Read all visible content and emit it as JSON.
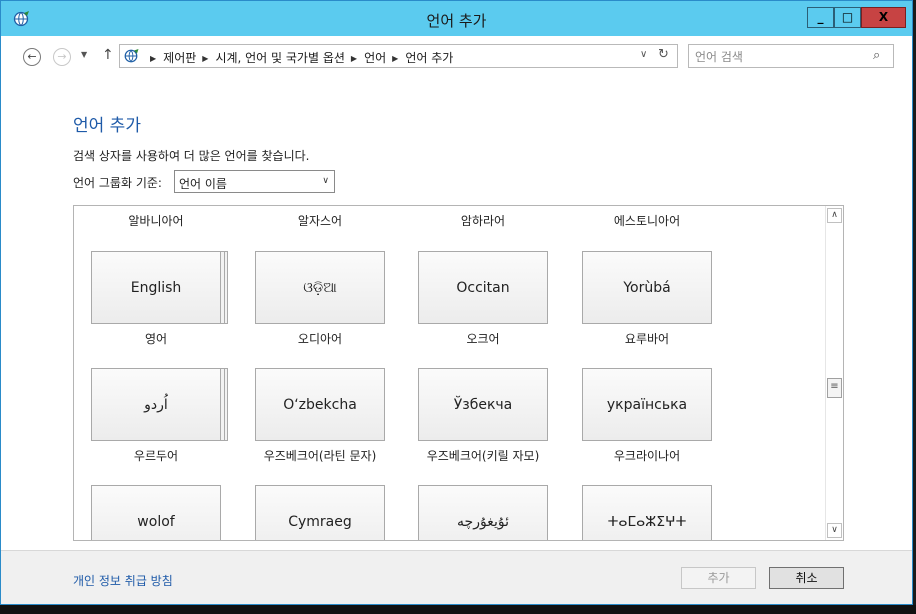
{
  "window": {
    "title": "언어 추가"
  },
  "title_buttons": {
    "minimize": "_",
    "maximize": "□",
    "close": "X"
  },
  "address": {
    "breadcrumbs": [
      "제어판",
      "시계, 언어 및 국가별 옵션",
      "언어",
      "언어 추가"
    ]
  },
  "search": {
    "placeholder": "언어 검색"
  },
  "page": {
    "heading": "언어 추가",
    "description": "검색 상자를 사용하여 더 많은 언어를 찾습니다.",
    "group_label": "언어 그룹화 기준:",
    "group_value": "언어 이름"
  },
  "languages": {
    "row0_names": [
      "알바니아어",
      "알자스어",
      "암하라어",
      "에스토니아어"
    ],
    "row1": [
      {
        "native": "English",
        "name": "영어"
      },
      {
        "native": "ଓଡ଼ିଆ",
        "name": "오디아어"
      },
      {
        "native": "Occitan",
        "name": "오크어"
      },
      {
        "native": "Yorùbá",
        "name": "요루바어"
      }
    ],
    "row2": [
      {
        "native": "اُردو",
        "name": "우르두어"
      },
      {
        "native": "O‘zbekcha",
        "name": "우즈베크어(라틴 문자)"
      },
      {
        "native": "Ўзбекча",
        "name": "우즈베크어(키릴 자모)"
      },
      {
        "native": "українська",
        "name": "우크라이나어"
      }
    ],
    "row3": [
      {
        "native": "wolof"
      },
      {
        "native": "Cymraeg"
      },
      {
        "native": "ئۇيغۇرچە"
      },
      {
        "native": "ⵜⴰⵎⴰⵣⵉⵖⵜ"
      }
    ]
  },
  "footer": {
    "privacy_link": "개인 정보 취급 방침",
    "add_button": "추가",
    "cancel_button": "취소"
  },
  "colors": {
    "titlebar": "#5bcbef",
    "link": "#1e5aa8",
    "close_button": "#c74343"
  }
}
